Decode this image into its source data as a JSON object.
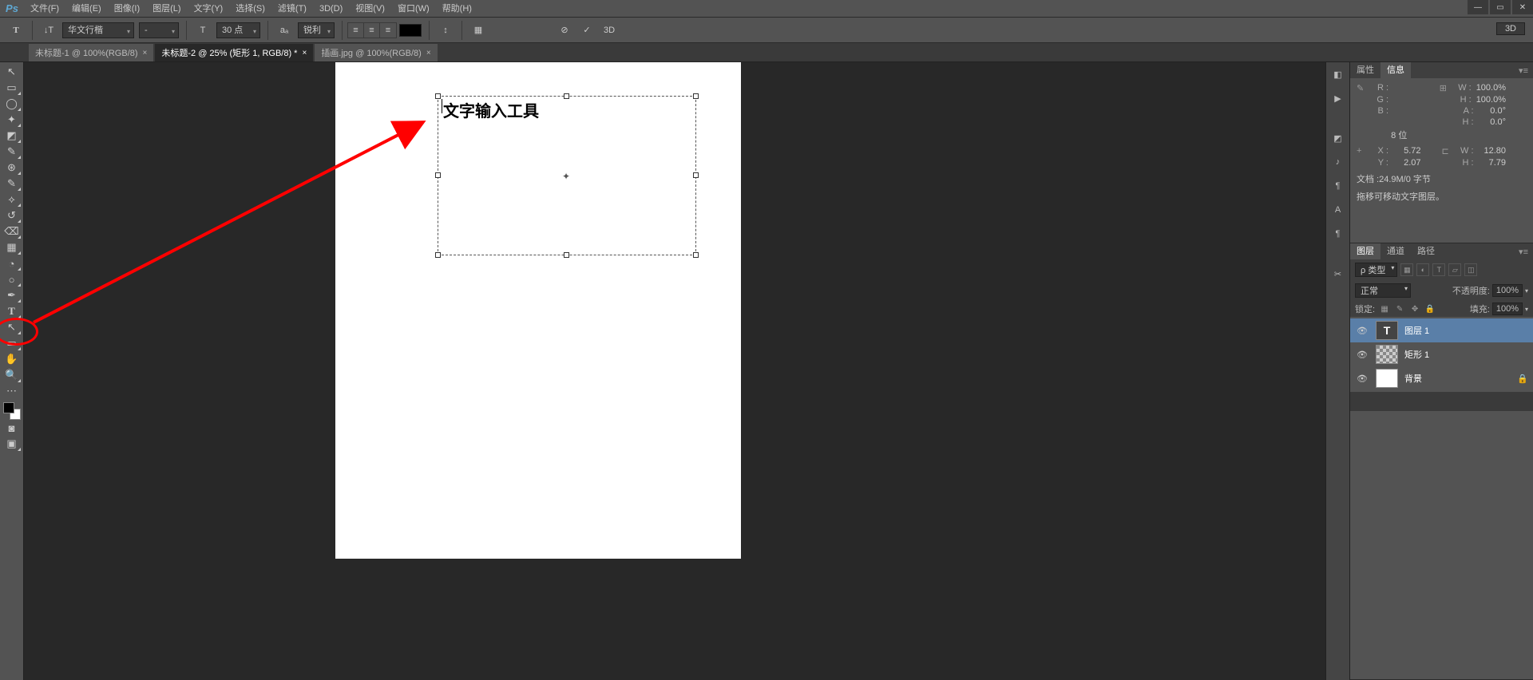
{
  "menubar": {
    "logo": "Ps",
    "items": [
      "文件(F)",
      "编辑(E)",
      "图像(I)",
      "图层(L)",
      "文字(Y)",
      "选择(S)",
      "滤镜(T)",
      "3D(D)",
      "视图(V)",
      "窗口(W)",
      "帮助(H)"
    ]
  },
  "options": {
    "tool_icon": "T",
    "orient_icon": "↓T",
    "font": "华文行楷",
    "style": "-",
    "size_icon": "T",
    "size": "30 点",
    "aa_icon": "aₐ",
    "aa": "锐利",
    "color": "#000000",
    "warp_icon": "↕",
    "grid_icon": "▦",
    "cancel_icon": "⊘",
    "commit_icon": "✓",
    "threeD": "3D",
    "right_3d": "3D"
  },
  "tabs": [
    {
      "label": "未标题-1 @ 100%(RGB/8)",
      "close": "×",
      "active": false
    },
    {
      "label": "未标题-2 @ 25% (矩形 1, RGB/8) *",
      "close": "×",
      "active": true
    },
    {
      "label": "插画.jpg @ 100%(RGB/8)",
      "close": "×",
      "active": false
    }
  ],
  "canvas": {
    "text": "文字输入工具"
  },
  "tools": [
    "↖",
    "▭",
    "◯",
    "✧",
    "◩",
    "✂",
    "✎",
    "⊘",
    "✒",
    "✎",
    "⟡",
    "⌫",
    "△",
    "✎",
    "▭",
    "◆",
    "◔",
    "○",
    "✎",
    "T",
    "↖",
    "▭",
    "✋",
    "🔍",
    "…"
  ],
  "rdock_icons": [
    "▣",
    "▶",
    "",
    "◧",
    "♪",
    "¶",
    "A",
    "¶",
    "",
    "✂"
  ],
  "info": {
    "tab_props": "属性",
    "tab_info": "信息",
    "r": "R :",
    "g": "G :",
    "b": "B :",
    "w": "W :",
    "wv": "100.0%",
    "h": "H :",
    "hv": "100.0%",
    "a": "A :",
    "av": "0.0°",
    "h2": "H :",
    "h2v": "0.0°",
    "bit": "8 位",
    "x": "X :",
    "xv": "5.72",
    "y": "Y :",
    "yv": "2.07",
    "w2": "W :",
    "w2v": "12.80",
    "h3": "H :",
    "h3v": "7.79",
    "doc": "文档 :24.9M/0 字节",
    "hint": "拖移可移动文字图层。"
  },
  "layers": {
    "tab_layers": "图层",
    "tab_channels": "通道",
    "tab_paths": "路径",
    "kind": "ρ 类型",
    "blend": "正常",
    "opacity_lbl": "不透明度:",
    "opacity": "100%",
    "lock_lbl": "锁定:",
    "fill_lbl": "填充:",
    "fill": "100%",
    "items": [
      {
        "name": "图层 1",
        "type": "text",
        "sel": true,
        "thumb": "T"
      },
      {
        "name": "矩形 1",
        "type": "shape",
        "sel": false,
        "thumb": ""
      },
      {
        "name": "背景",
        "type": "bg",
        "sel": false,
        "thumb": "",
        "lock": true
      }
    ]
  }
}
